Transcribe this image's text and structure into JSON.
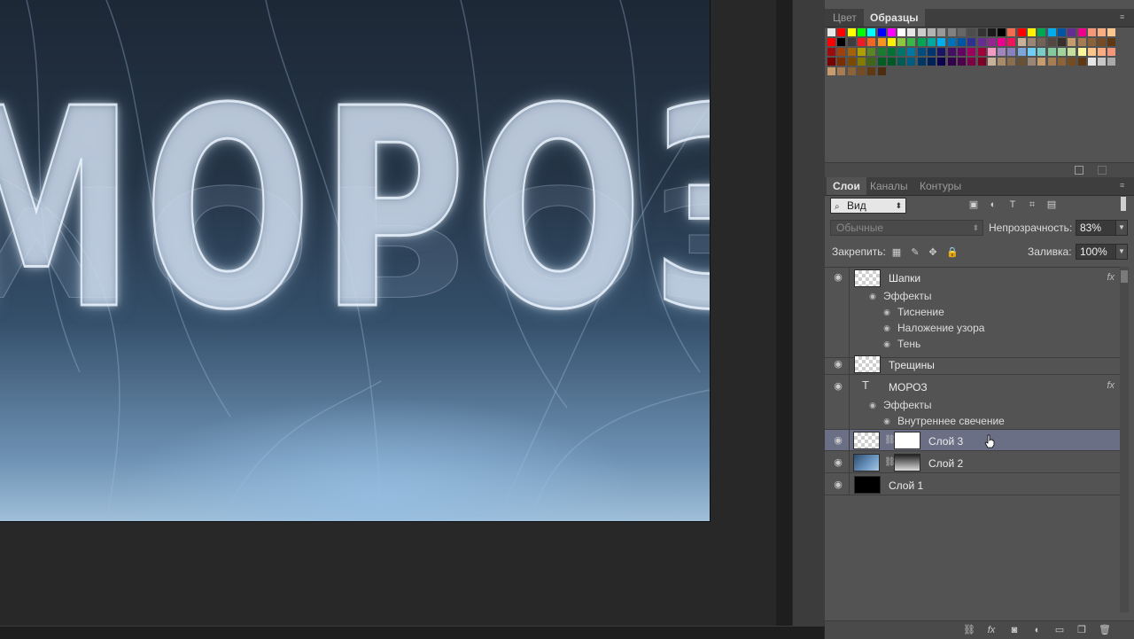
{
  "canvas": {
    "headline": "МОРОЗ"
  },
  "swatch_panel": {
    "tabs": [
      "Цвет",
      "Образцы"
    ],
    "active_tab": "Образцы",
    "colors": {
      "row1": [
        "#e8e8e8",
        "#ff0000",
        "#ffff00",
        "#00ff00",
        "#00ffff",
        "#0000ff",
        "#ff00ff",
        "#ffffff",
        "#e6e6e6",
        "#cccccc",
        "#b3b3b3",
        "#999999",
        "#808080",
        "#666666",
        "#4d4d4d",
        "#333333",
        "#1a1a1a",
        "#000000",
        "#f26c4f",
        "#ff0000",
        "#fff200",
        "#00a651",
        "#00aeef",
        "#0054a6",
        "#662d91",
        "#ec008c",
        "#f7977a",
        "#fbad82",
        "#fdc68c"
      ],
      "row2": [
        "#ff0000",
        "#000000",
        "#3d3d3d",
        "#ed1c24",
        "#f26522",
        "#f7941d",
        "#fff200",
        "#8dc63f",
        "#39b54a",
        "#00a651",
        "#00a99d",
        "#00aeef",
        "#0072bc",
        "#0054a6",
        "#2e3192",
        "#662d91",
        "#92278f",
        "#ec008c",
        "#ed145b",
        "#c7b299",
        "#998675",
        "#736357",
        "#534741",
        "#37302a",
        "#c69c6d",
        "#a67c52",
        "#8c6239",
        "#754c24",
        "#603913"
      ],
      "row3": [
        "#9e0b0f",
        "#a0410d",
        "#a36209",
        "#aba000",
        "#598527",
        "#1a7b30",
        "#007236",
        "#00746b",
        "#0076a3",
        "#004b80",
        "#003471",
        "#1b1464",
        "#440e62",
        "#630460",
        "#9e005d",
        "#9e0039",
        "#f49ac2",
        "#a186be",
        "#8781bd",
        "#7da7d9",
        "#6dcff6",
        "#7accc8",
        "#82ca9c",
        "#a3d39c",
        "#c4df9b",
        "#fff799",
        "#fdc689",
        "#f9ad81",
        "#f69679"
      ],
      "row4": [
        "#790000",
        "#7b2e00",
        "#7d4900",
        "#827b00",
        "#406618",
        "#005e20",
        "#005826",
        "#005952",
        "#005b7f",
        "#003663",
        "#002157",
        "#0d004c",
        "#32004b",
        "#4b0049",
        "#7b0046",
        "#7a0026",
        "#c7b299",
        "#a88a6a",
        "#8a6d4e",
        "#6b5133",
        "#998675",
        "#c69c6d",
        "#a67c52",
        "#8c6239",
        "#754c24",
        "#603913",
        "#e6e6e6",
        "#c7c7c7",
        "#a9a9a9"
      ],
      "row5": [
        "#c69c6d",
        "#a67c52",
        "#8c6239",
        "#754c24",
        "#603913",
        "#4d2d0f"
      ]
    }
  },
  "layers_panel": {
    "tabs": [
      "Слои",
      "Каналы",
      "Контуры"
    ],
    "active_tab": "Слои",
    "kind_filter": "Вид",
    "blend_mode": "Обычные",
    "opacity_label": "Непрозрачность:",
    "opacity_value": "83%",
    "lock_label": "Закрепить:",
    "fill_label": "Заливка:",
    "fill_value": "100%",
    "layers": [
      {
        "name": "Шапки",
        "effects_label": "Эффекты",
        "effects": [
          "Тиснение",
          "Наложение узора",
          "Тень"
        ]
      },
      {
        "name": "Трещины"
      },
      {
        "name": "МОРОЗ",
        "type": "text",
        "effects_label": "Эффекты",
        "effects": [
          "Внутреннее свечение"
        ]
      },
      {
        "name": "Слой 3",
        "selected": true
      },
      {
        "name": "Слой 2"
      },
      {
        "name": "Слой 1"
      }
    ],
    "fx_glyph": "fx"
  }
}
